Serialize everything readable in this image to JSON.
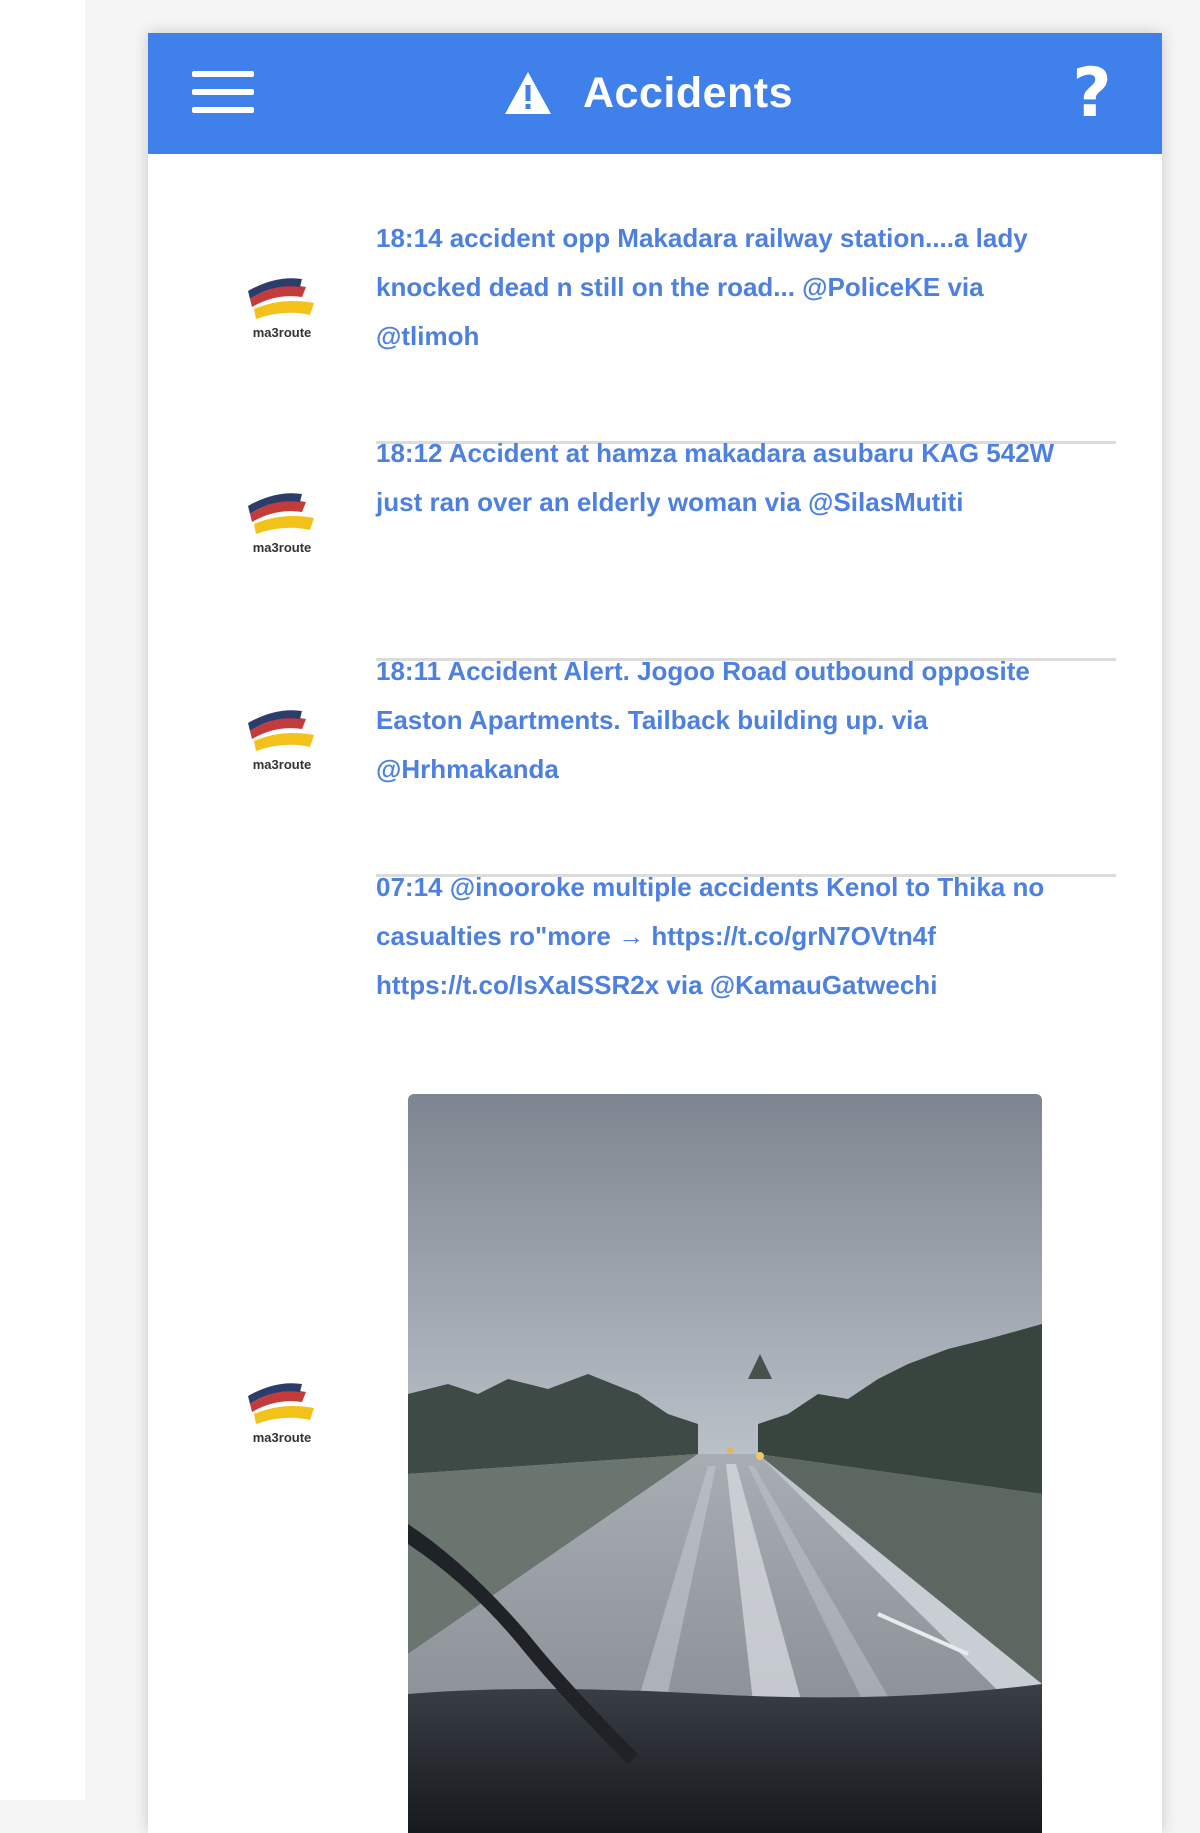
{
  "header": {
    "title": "Accidents",
    "menu_icon": "hamburger-menu-icon",
    "alert_icon": "warning-triangle-icon",
    "help_label": "?"
  },
  "colors": {
    "appbar": "#3f80ea",
    "link_text": "#4d80e0",
    "divider": "#dcdcdc"
  },
  "feed": {
    "items": [
      {
        "avatar_icon": "ma3route-logo-icon",
        "text": "18:14 accident opp Makadara railway station....a lady knocked dead n still on the road... @PoliceKE via @tlimoh"
      },
      {
        "avatar_icon": "ma3route-logo-icon",
        "text": "18:12 Accident at hamza makadara asubaru KAG 542W just ran over an elderly woman via @SilasMutiti"
      },
      {
        "avatar_icon": "ma3route-logo-icon",
        "text": "18:11 Accident Alert. Jogoo Road outbound opposite Easton Apartments. Tailback building up. via @Hrhmakanda"
      },
      {
        "avatar_icon": "ma3route-logo-icon",
        "text": "07:14 @inooroke multiple accidents Kenol to Thika no casualties ro\"more → https://t.co/grN7OVtn4f https://t.co/IsXaISSR2x via @KamauGatwechi",
        "photo": "rainy-road-windshield-photo"
      }
    ]
  }
}
